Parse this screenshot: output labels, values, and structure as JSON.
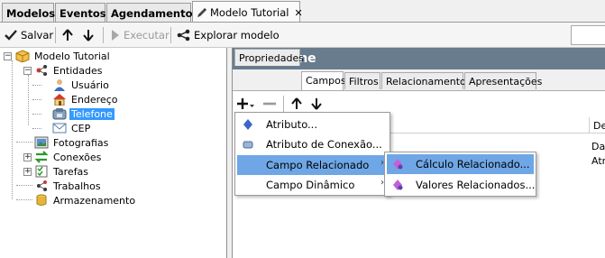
{
  "top_tabs": [
    {
      "label": "Modelos"
    },
    {
      "label": "Eventos"
    },
    {
      "label": "Agendamentos"
    },
    {
      "label": "Modelo Tutorial",
      "close": "✕"
    }
  ],
  "toolbar": {
    "save_label": "Salvar",
    "execute_label": "Executar",
    "explore_label": "Explorar modelo"
  },
  "tree": {
    "root": "Modelo Tutorial",
    "entities": "Entidades",
    "usuario": "Usuário",
    "endereco": "Endereço",
    "telefone": "Telefone",
    "cep": "CEP",
    "fotografias": "Fotografias",
    "conexoes": "Conexões",
    "tarefas": "Tarefas",
    "trabalhos": "Trabalhos",
    "armazenamento": "Armazenamento"
  },
  "panel": {
    "title": "Telefone",
    "tabs": [
      {
        "label": "Propriedades"
      },
      {
        "label": "Campos"
      },
      {
        "label": "Filtros"
      },
      {
        "label": "Relacionamentos"
      },
      {
        "label": "Apresentações"
      }
    ],
    "grid_header_partial": "De",
    "cells": [
      "Dat",
      "Atr"
    ]
  },
  "menu": {
    "items": [
      {
        "label": "Atributo..."
      },
      {
        "label": "Atributo de Conexão..."
      },
      {
        "label": "Campo Relacionado",
        "arrow": "›"
      },
      {
        "label": "Campo Dinâmico",
        "arrow": "›"
      }
    ],
    "submenu": [
      {
        "label": "Cálculo Relacionado..."
      },
      {
        "label": "Valores Relacionados..."
      }
    ]
  },
  "colors": {
    "header_bg": "#687c8e",
    "selection": "#3399ff",
    "menu_highlight": "#6fa7e6"
  }
}
